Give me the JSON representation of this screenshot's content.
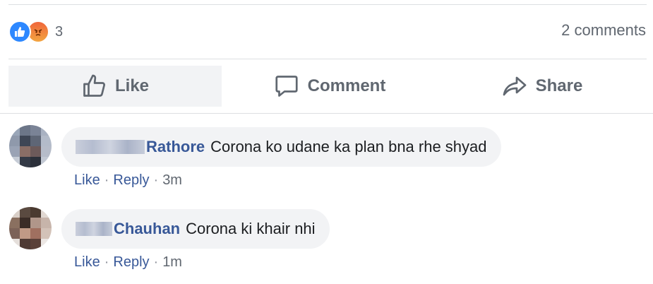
{
  "reactions": {
    "count": "3",
    "icons": [
      "like-icon",
      "angry-icon"
    ],
    "colors": {
      "like": "#2d88ff",
      "angry": "#f0663b"
    }
  },
  "comments_count": "2 comments",
  "actions": {
    "like": "Like",
    "comment": "Comment",
    "share": "Share"
  },
  "comments": [
    {
      "author": "Rathore",
      "text": "Corona ko udane ka plan bna rhe shyad",
      "like": "Like",
      "reply": "Reply",
      "time": "3m"
    },
    {
      "author": "Chauhan",
      "text": "Corona ki khair nhi",
      "like": "Like",
      "reply": "Reply",
      "time": "1m"
    }
  ]
}
